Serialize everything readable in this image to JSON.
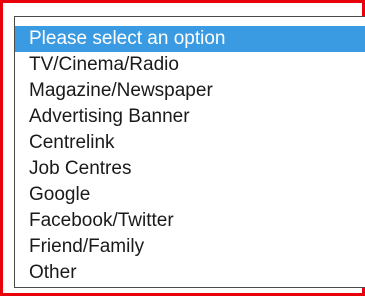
{
  "select": {
    "selected_index": 0,
    "options": [
      "Please select an option",
      "TV/Cinema/Radio",
      "Magazine/Newspaper",
      "Advertising Banner",
      "Centrelink",
      "Job Centres",
      "Google",
      "Facebook/Twitter",
      "Friend/Family",
      "Other"
    ]
  },
  "colors": {
    "highlight_border": "#e8000a",
    "selection": "#3b9be2",
    "list_border": "#4a4a4a"
  }
}
